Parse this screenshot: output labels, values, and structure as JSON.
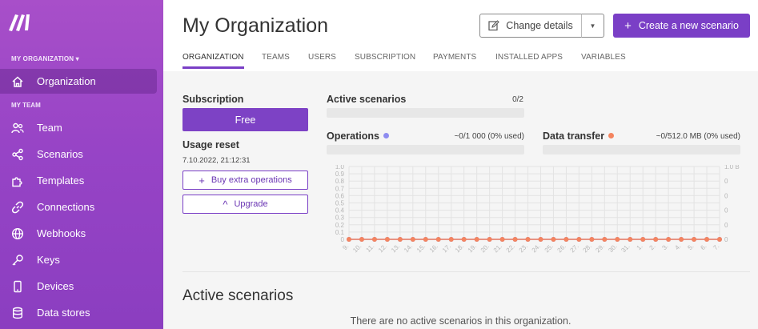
{
  "sidebar": {
    "org_switch": "MY ORGANIZATION ▾",
    "org_item": {
      "label": "Organization",
      "icon": "home-icon"
    },
    "team_heading": "MY TEAM",
    "items": [
      {
        "label": "Team",
        "icon": "users-icon"
      },
      {
        "label": "Scenarios",
        "icon": "share-icon"
      },
      {
        "label": "Templates",
        "icon": "puzzle-icon"
      },
      {
        "label": "Connections",
        "icon": "link-icon"
      },
      {
        "label": "Webhooks",
        "icon": "globe-icon"
      },
      {
        "label": "Keys",
        "icon": "key-icon"
      },
      {
        "label": "Devices",
        "icon": "phone-icon"
      },
      {
        "label": "Data stores",
        "icon": "database-icon"
      }
    ]
  },
  "header": {
    "title": "My Organization",
    "change_details": "Change details",
    "create_scenario": "Create a new scenario"
  },
  "tabs": [
    "ORGANIZATION",
    "TEAMS",
    "USERS",
    "SUBSCRIPTION",
    "PAYMENTS",
    "INSTALLED APPS",
    "VARIABLES"
  ],
  "subscription": {
    "heading": "Subscription",
    "plan": "Free",
    "usage_reset_label": "Usage reset",
    "usage_reset_date": "7.10.2022, 21:12:31",
    "buy_button": "Buy extra operations",
    "upgrade_button": "Upgrade"
  },
  "stats": {
    "active_scenarios_label": "Active scenarios",
    "active_scenarios_value": "0/2",
    "active_scenarios_fraction": 0,
    "operations_label": "Operations",
    "operations_value": "~0/1 000 (0% used)",
    "operations_fraction": 0,
    "operations_color": "#8e8cf0",
    "transfer_label": "Data transfer",
    "transfer_value": "~0/512.0 MB (0% used)",
    "transfer_fraction": 0,
    "transfer_color": "#f4845f"
  },
  "chart_data": {
    "type": "line",
    "x": [
      "9.",
      "10.",
      "11.",
      "12.",
      "13.",
      "14.",
      "15.",
      "16.",
      "17.",
      "18.",
      "19.",
      "20.",
      "21.",
      "22.",
      "23.",
      "24.",
      "25.",
      "26.",
      "27.",
      "28.",
      "29.",
      "30.",
      "31.",
      "1.",
      "2.",
      "3.",
      "4.",
      "5.",
      "6.",
      "7."
    ],
    "left_ticks": [
      "0",
      "0.1",
      "0.2",
      "0.3",
      "0.4",
      "0.5",
      "0.6",
      "0.7",
      "0.8",
      "0.9",
      "1.0"
    ],
    "right_ticks": [
      "0",
      "0",
      "0",
      "0",
      "0",
      "1.0 B"
    ],
    "ylim": [
      0,
      1
    ],
    "grid": true,
    "series": [
      {
        "values": [
          0,
          0,
          0,
          0,
          0,
          0,
          0,
          0,
          0,
          0,
          0,
          0,
          0,
          0,
          0,
          0,
          0,
          0,
          0,
          0,
          0,
          0,
          0,
          0,
          0,
          0,
          0,
          0,
          0,
          0
        ],
        "color": "#8e8cf0"
      },
      {
        "values": [
          0,
          0,
          0,
          0,
          0,
          0,
          0,
          0,
          0,
          0,
          0,
          0,
          0,
          0,
          0,
          0,
          0,
          0,
          0,
          0,
          0,
          0,
          0,
          0,
          0,
          0,
          0,
          0,
          0,
          0
        ],
        "color": "#f4845f"
      }
    ]
  },
  "active_scenarios": {
    "title": "Active scenarios",
    "empty_message": "There are no active scenarios in this organization."
  }
}
